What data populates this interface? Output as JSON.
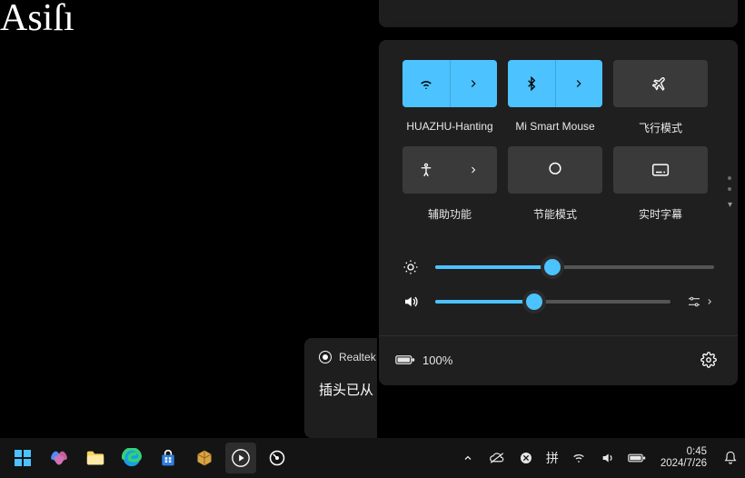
{
  "watermark": "Asiſı",
  "panel": {
    "tiles": [
      {
        "name": "wifi",
        "label": "HUAZHU-Hanting",
        "on": true,
        "split": true
      },
      {
        "name": "bluetooth",
        "label": "Mi Smart Mouse",
        "on": true,
        "split": true
      },
      {
        "name": "airplane",
        "label": "飞行模式",
        "on": false,
        "split": false
      },
      {
        "name": "accessibility",
        "label": "辅助功能",
        "on": false,
        "split": true
      },
      {
        "name": "battery-saver",
        "label": "节能模式",
        "on": false,
        "split": false
      },
      {
        "name": "captions",
        "label": "实时字幕",
        "on": false,
        "split": false
      }
    ],
    "brightness": 42,
    "volume": 42,
    "battery_pct": "100%"
  },
  "notification": {
    "app": "Realtek",
    "body": "插头已从"
  },
  "tray": {
    "ime": "拼",
    "time": "0:45",
    "date": "2024/7/26"
  }
}
